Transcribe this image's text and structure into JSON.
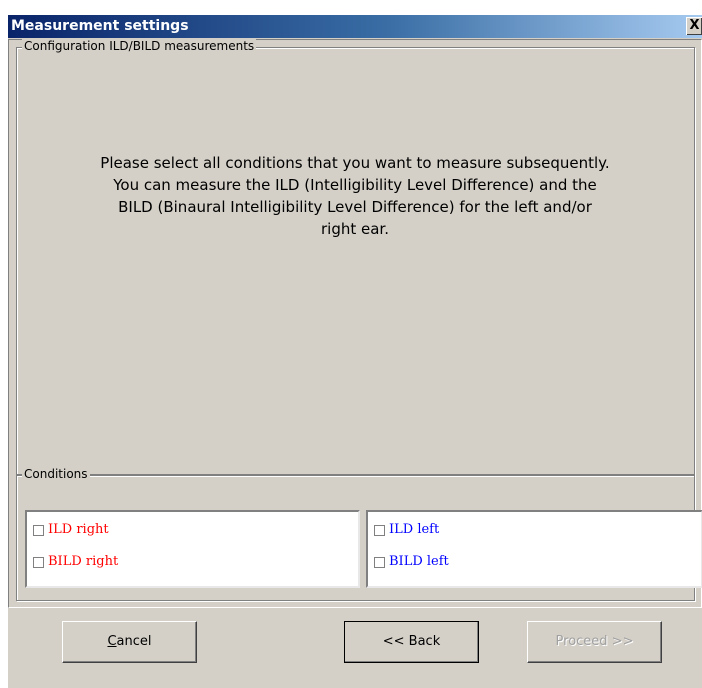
{
  "window": {
    "title": "Measurement settings",
    "close_glyph": "X",
    "close_icon": "close-icon"
  },
  "config_group": {
    "legend": "Configuration ILD/BILD measurements",
    "instructions": [
      "Please select all conditions that you want to measure subsequently.",
      "You can measure the ILD (Intelligibility Level Difference) and the",
      "BILD (Binaural Intelligibility Level Difference) for the left and/or",
      "right ear."
    ]
  },
  "conditions_group": {
    "legend": "Conditions",
    "right_ear": [
      {
        "label": "ILD right",
        "checked": false
      },
      {
        "label": "BILD right",
        "checked": false
      }
    ],
    "left_ear": [
      {
        "label": "ILD left",
        "checked": false
      },
      {
        "label": "BILD left",
        "checked": false
      }
    ],
    "right_color": "#ff0000",
    "left_color": "#0000ff"
  },
  "buttons": {
    "cancel_first_letter": "C",
    "cancel_rest": "ancel",
    "back_label": "<< Back",
    "proceed_label": "Proceed >>",
    "proceed_enabled": false
  }
}
